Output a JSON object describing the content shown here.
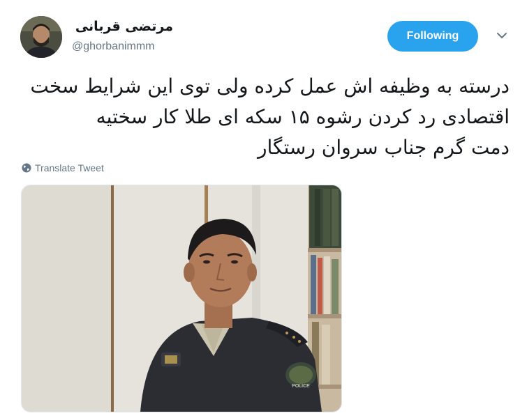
{
  "tweet": {
    "author": {
      "display_name": "مرتضی قربانی",
      "handle": "@ghorbanimmm"
    },
    "follow_button_label": "Following",
    "text_lines": [
      "درسته به وظیفه اش عمل کرده ولی توی این شرایط سخت",
      "اقتصادی رد کردن رشوه ۱۵ سکه ای طلا کار سختیه",
      "دمت گرم جناب سروان رستگار"
    ],
    "translate_label": "Translate Tweet",
    "media": {
      "badge_text": "POLICE"
    }
  },
  "icons": {
    "menu": "chevron-down-icon",
    "translate": "globe-icon"
  },
  "colors": {
    "follow_button": "#2aa3ef",
    "secondary_text": "#657786",
    "primary_text": "#14171a"
  }
}
